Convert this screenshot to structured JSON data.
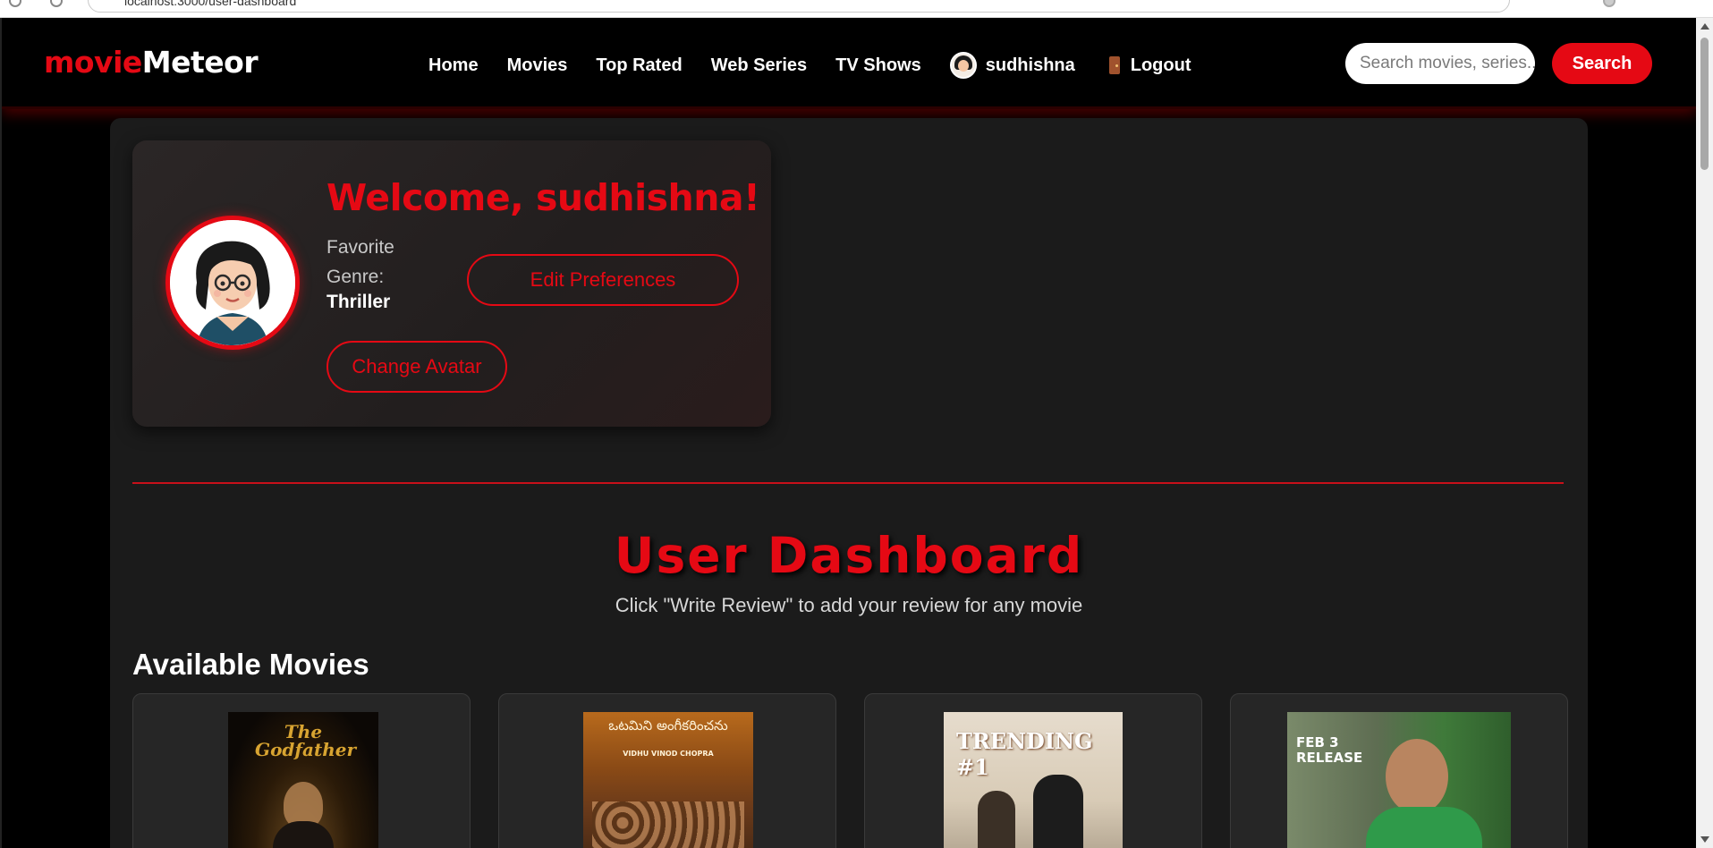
{
  "browser": {
    "url": "localhost:3000/user-dashboard"
  },
  "navbar": {
    "logo_part1": "movie",
    "logo_part2": "Meteor",
    "links": [
      "Home",
      "Movies",
      "Top Rated",
      "Web Series",
      "TV Shows"
    ],
    "username": "sudhishna",
    "logout_label": "Logout",
    "search_placeholder": "Search movies, series...",
    "search_button": "Search"
  },
  "profile": {
    "welcome": "Welcome, sudhishna!",
    "favorite_genre_label": "Favorite Genre:",
    "favorite_genre_value": "Thriller",
    "edit_preferences": "Edit Preferences",
    "change_avatar": "Change Avatar"
  },
  "dashboard": {
    "title": "User Dashboard",
    "subtitle": "Click \"Write Review\" to add your review for any movie",
    "section_title": "Available Movies"
  },
  "movies": [
    {
      "poster_title": "The Godfather"
    },
    {
      "poster_title": "ఒటమిని అంగీకరించను",
      "poster_subtitle": "VIDHU VINOD CHOPRA"
    },
    {
      "poster_title": "TRENDING #1"
    },
    {
      "poster_title": "FEB 3 RELEASE"
    }
  ],
  "colors": {
    "accent": "#e50914",
    "background": "#000000",
    "panel": "#1b1b1b"
  }
}
